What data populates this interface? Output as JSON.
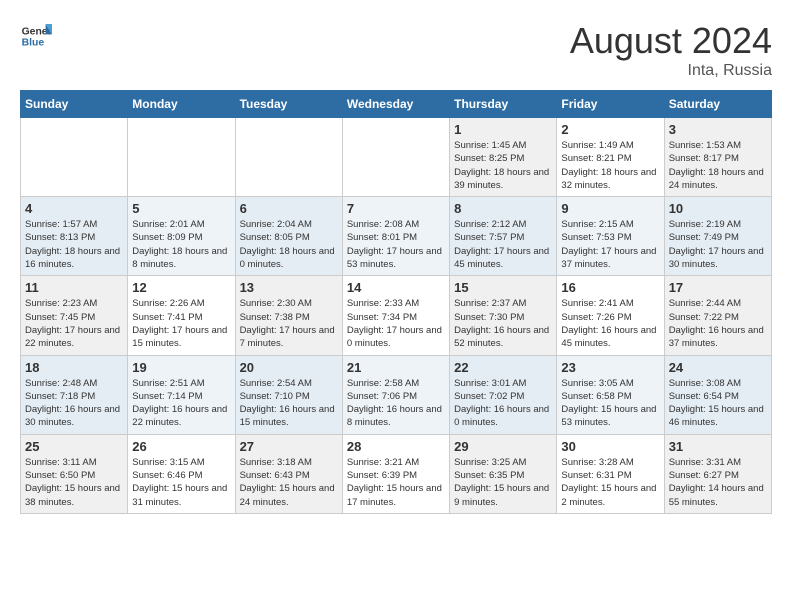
{
  "header": {
    "logo": {
      "line1": "General",
      "line2": "Blue"
    },
    "month_year": "August 2024",
    "location": "Inta, Russia"
  },
  "weekdays": [
    "Sunday",
    "Monday",
    "Tuesday",
    "Wednesday",
    "Thursday",
    "Friday",
    "Saturday"
  ],
  "weeks": [
    [
      {
        "day": "",
        "sunrise": "",
        "sunset": "",
        "daylight": ""
      },
      {
        "day": "",
        "sunrise": "",
        "sunset": "",
        "daylight": ""
      },
      {
        "day": "",
        "sunrise": "",
        "sunset": "",
        "daylight": ""
      },
      {
        "day": "",
        "sunrise": "",
        "sunset": "",
        "daylight": ""
      },
      {
        "day": "1",
        "sunrise": "Sunrise: 1:45 AM",
        "sunset": "Sunset: 8:25 PM",
        "daylight": "Daylight: 18 hours and 39 minutes."
      },
      {
        "day": "2",
        "sunrise": "Sunrise: 1:49 AM",
        "sunset": "Sunset: 8:21 PM",
        "daylight": "Daylight: 18 hours and 32 minutes."
      },
      {
        "day": "3",
        "sunrise": "Sunrise: 1:53 AM",
        "sunset": "Sunset: 8:17 PM",
        "daylight": "Daylight: 18 hours and 24 minutes."
      }
    ],
    [
      {
        "day": "4",
        "sunrise": "Sunrise: 1:57 AM",
        "sunset": "Sunset: 8:13 PM",
        "daylight": "Daylight: 18 hours and 16 minutes."
      },
      {
        "day": "5",
        "sunrise": "Sunrise: 2:01 AM",
        "sunset": "Sunset: 8:09 PM",
        "daylight": "Daylight: 18 hours and 8 minutes."
      },
      {
        "day": "6",
        "sunrise": "Sunrise: 2:04 AM",
        "sunset": "Sunset: 8:05 PM",
        "daylight": "Daylight: 18 hours and 0 minutes."
      },
      {
        "day": "7",
        "sunrise": "Sunrise: 2:08 AM",
        "sunset": "Sunset: 8:01 PM",
        "daylight": "Daylight: 17 hours and 53 minutes."
      },
      {
        "day": "8",
        "sunrise": "Sunrise: 2:12 AM",
        "sunset": "Sunset: 7:57 PM",
        "daylight": "Daylight: 17 hours and 45 minutes."
      },
      {
        "day": "9",
        "sunrise": "Sunrise: 2:15 AM",
        "sunset": "Sunset: 7:53 PM",
        "daylight": "Daylight: 17 hours and 37 minutes."
      },
      {
        "day": "10",
        "sunrise": "Sunrise: 2:19 AM",
        "sunset": "Sunset: 7:49 PM",
        "daylight": "Daylight: 17 hours and 30 minutes."
      }
    ],
    [
      {
        "day": "11",
        "sunrise": "Sunrise: 2:23 AM",
        "sunset": "Sunset: 7:45 PM",
        "daylight": "Daylight: 17 hours and 22 minutes."
      },
      {
        "day": "12",
        "sunrise": "Sunrise: 2:26 AM",
        "sunset": "Sunset: 7:41 PM",
        "daylight": "Daylight: 17 hours and 15 minutes."
      },
      {
        "day": "13",
        "sunrise": "Sunrise: 2:30 AM",
        "sunset": "Sunset: 7:38 PM",
        "daylight": "Daylight: 17 hours and 7 minutes."
      },
      {
        "day": "14",
        "sunrise": "Sunrise: 2:33 AM",
        "sunset": "Sunset: 7:34 PM",
        "daylight": "Daylight: 17 hours and 0 minutes."
      },
      {
        "day": "15",
        "sunrise": "Sunrise: 2:37 AM",
        "sunset": "Sunset: 7:30 PM",
        "daylight": "Daylight: 16 hours and 52 minutes."
      },
      {
        "day": "16",
        "sunrise": "Sunrise: 2:41 AM",
        "sunset": "Sunset: 7:26 PM",
        "daylight": "Daylight: 16 hours and 45 minutes."
      },
      {
        "day": "17",
        "sunrise": "Sunrise: 2:44 AM",
        "sunset": "Sunset: 7:22 PM",
        "daylight": "Daylight: 16 hours and 37 minutes."
      }
    ],
    [
      {
        "day": "18",
        "sunrise": "Sunrise: 2:48 AM",
        "sunset": "Sunset: 7:18 PM",
        "daylight": "Daylight: 16 hours and 30 minutes."
      },
      {
        "day": "19",
        "sunrise": "Sunrise: 2:51 AM",
        "sunset": "Sunset: 7:14 PM",
        "daylight": "Daylight: 16 hours and 22 minutes."
      },
      {
        "day": "20",
        "sunrise": "Sunrise: 2:54 AM",
        "sunset": "Sunset: 7:10 PM",
        "daylight": "Daylight: 16 hours and 15 minutes."
      },
      {
        "day": "21",
        "sunrise": "Sunrise: 2:58 AM",
        "sunset": "Sunset: 7:06 PM",
        "daylight": "Daylight: 16 hours and 8 minutes."
      },
      {
        "day": "22",
        "sunrise": "Sunrise: 3:01 AM",
        "sunset": "Sunset: 7:02 PM",
        "daylight": "Daylight: 16 hours and 0 minutes."
      },
      {
        "day": "23",
        "sunrise": "Sunrise: 3:05 AM",
        "sunset": "Sunset: 6:58 PM",
        "daylight": "Daylight: 15 hours and 53 minutes."
      },
      {
        "day": "24",
        "sunrise": "Sunrise: 3:08 AM",
        "sunset": "Sunset: 6:54 PM",
        "daylight": "Daylight: 15 hours and 46 minutes."
      }
    ],
    [
      {
        "day": "25",
        "sunrise": "Sunrise: 3:11 AM",
        "sunset": "Sunset: 6:50 PM",
        "daylight": "Daylight: 15 hours and 38 minutes."
      },
      {
        "day": "26",
        "sunrise": "Sunrise: 3:15 AM",
        "sunset": "Sunset: 6:46 PM",
        "daylight": "Daylight: 15 hours and 31 minutes."
      },
      {
        "day": "27",
        "sunrise": "Sunrise: 3:18 AM",
        "sunset": "Sunset: 6:43 PM",
        "daylight": "Daylight: 15 hours and 24 minutes."
      },
      {
        "day": "28",
        "sunrise": "Sunrise: 3:21 AM",
        "sunset": "Sunset: 6:39 PM",
        "daylight": "Daylight: 15 hours and 17 minutes."
      },
      {
        "day": "29",
        "sunrise": "Sunrise: 3:25 AM",
        "sunset": "Sunset: 6:35 PM",
        "daylight": "Daylight: 15 hours and 9 minutes."
      },
      {
        "day": "30",
        "sunrise": "Sunrise: 3:28 AM",
        "sunset": "Sunset: 6:31 PM",
        "daylight": "Daylight: 15 hours and 2 minutes."
      },
      {
        "day": "31",
        "sunrise": "Sunrise: 3:31 AM",
        "sunset": "Sunset: 6:27 PM",
        "daylight": "Daylight: 14 hours and 55 minutes."
      }
    ]
  ]
}
